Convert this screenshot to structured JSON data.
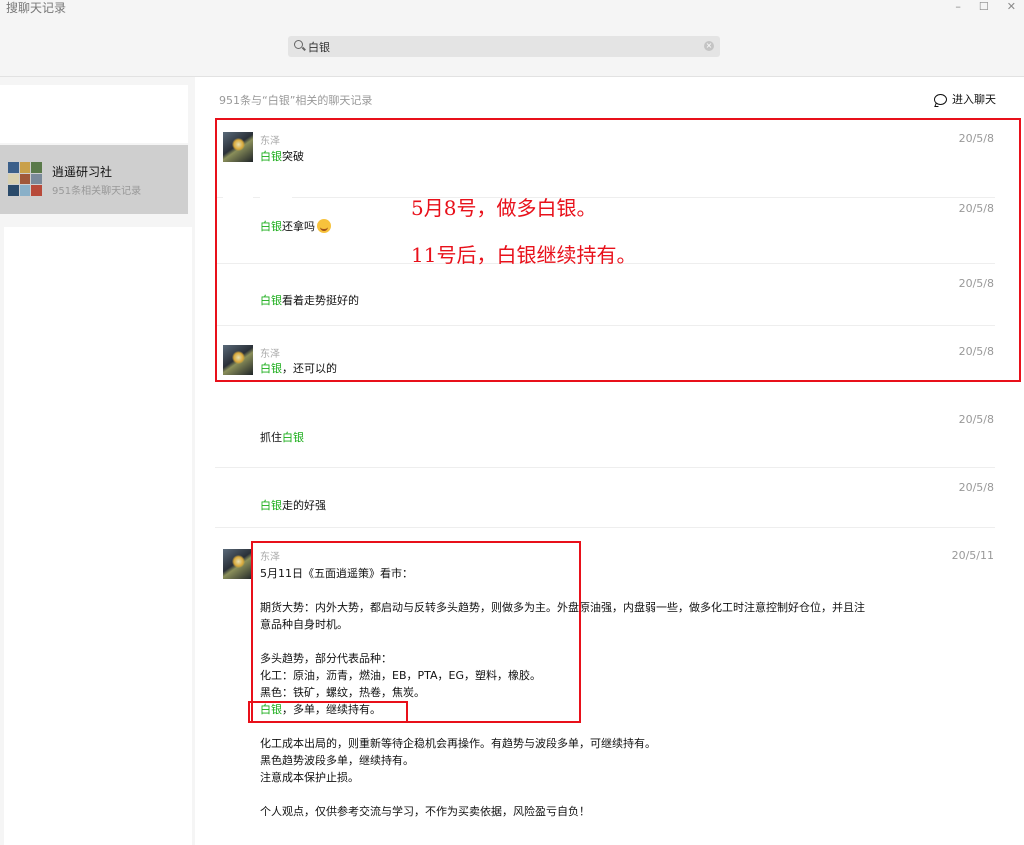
{
  "window": {
    "title": "搜聊天记录",
    "min": "–",
    "max": "☐",
    "close": "✕"
  },
  "search": {
    "value": "白银",
    "icon": "search-icon",
    "clear": "clear-icon"
  },
  "sidebar": {
    "items": [
      {
        "name": "逍遥研习社",
        "sub": "951条相关聊天记录",
        "icon": "group-avatar"
      }
    ]
  },
  "main": {
    "summary": "951条与“白银”相关的聊天记录",
    "enter_chat": "进入聊天",
    "enter_icon": "chat-bubble-icon"
  },
  "messages": [
    {
      "sender": "东泽",
      "highlight": "白银",
      "text": "突破",
      "date": "20/5/8"
    },
    {
      "sender": "",
      "highlight": "白银",
      "text": "还拿吗",
      "emoji": "laugh-cry-emoji",
      "date": "20/5/8"
    },
    {
      "sender": "",
      "highlight": "白银",
      "text": "看着走势挺好的",
      "date": "20/5/8"
    },
    {
      "sender": "东泽",
      "highlight": "白银",
      "text": "，还可以的",
      "date": "20/5/8"
    },
    {
      "sender": "",
      "prefix": "抓住",
      "highlight": "白银",
      "text": "",
      "date": "20/5/8"
    },
    {
      "sender": "",
      "highlight": "白银",
      "text": "走的好强",
      "date": "20/5/8"
    },
    {
      "sender": "东泽",
      "date": "20/5/11",
      "lines": [
        "5月11日《五面逍遥策》看市：",
        "",
        "期货大势：内外大势，都启动与反转多头趋势，则做多为主。外盘原油强，内盘弱一些，做多化工时注意控制好仓位，并且注",
        "意品种自身时机。",
        "",
        "多头趋势，部分代表品种：",
        "化工：原油，沥青，燃油，EB，PTA，EG，塑料，橡胶。",
        "黑色：铁矿，螺纹，热卷，焦炭。"
      ],
      "hl_line": {
        "highlight": "白银",
        "text": "，多单，继续持有。"
      },
      "lines2": [
        "",
        "化工成本出局的，则重新等待企稳机会再操作。有趋势与波段多单，可继续持有。",
        "黑色趋势波段多单，继续持有。",
        "注意成本保护止损。",
        "",
        "个人观点，仅供参考交流与学习，不作为买卖依据，风险盈亏自负！"
      ]
    }
  ],
  "annotations": [
    "5月8号，做多白银。",
    "11号后，白银继续持有。"
  ],
  "colors": {
    "highlight": "#1aad19",
    "annotation": "#e8101a",
    "selected_item": "#cfcfcf"
  }
}
